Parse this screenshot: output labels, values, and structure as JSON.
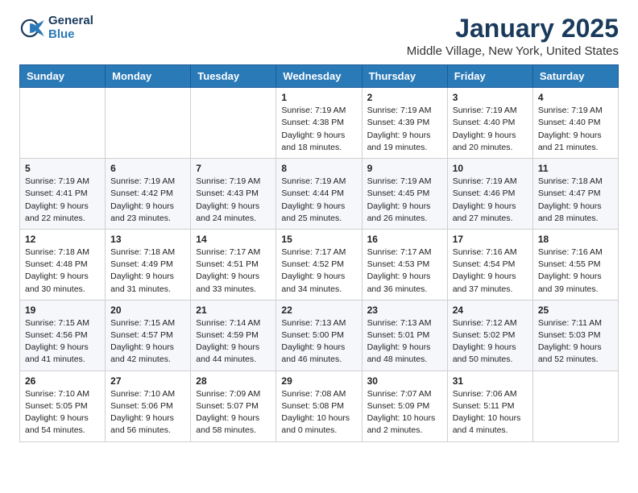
{
  "header": {
    "logo_line1": "General",
    "logo_line2": "Blue",
    "month_title": "January 2025",
    "location": "Middle Village, New York, United States"
  },
  "weekdays": [
    "Sunday",
    "Monday",
    "Tuesday",
    "Wednesday",
    "Thursday",
    "Friday",
    "Saturday"
  ],
  "weeks": [
    [
      {
        "day": "",
        "info": ""
      },
      {
        "day": "",
        "info": ""
      },
      {
        "day": "",
        "info": ""
      },
      {
        "day": "1",
        "info": "Sunrise: 7:19 AM\nSunset: 4:38 PM\nDaylight: 9 hours\nand 18 minutes."
      },
      {
        "day": "2",
        "info": "Sunrise: 7:19 AM\nSunset: 4:39 PM\nDaylight: 9 hours\nand 19 minutes."
      },
      {
        "day": "3",
        "info": "Sunrise: 7:19 AM\nSunset: 4:40 PM\nDaylight: 9 hours\nand 20 minutes."
      },
      {
        "day": "4",
        "info": "Sunrise: 7:19 AM\nSunset: 4:40 PM\nDaylight: 9 hours\nand 21 minutes."
      }
    ],
    [
      {
        "day": "5",
        "info": "Sunrise: 7:19 AM\nSunset: 4:41 PM\nDaylight: 9 hours\nand 22 minutes."
      },
      {
        "day": "6",
        "info": "Sunrise: 7:19 AM\nSunset: 4:42 PM\nDaylight: 9 hours\nand 23 minutes."
      },
      {
        "day": "7",
        "info": "Sunrise: 7:19 AM\nSunset: 4:43 PM\nDaylight: 9 hours\nand 24 minutes."
      },
      {
        "day": "8",
        "info": "Sunrise: 7:19 AM\nSunset: 4:44 PM\nDaylight: 9 hours\nand 25 minutes."
      },
      {
        "day": "9",
        "info": "Sunrise: 7:19 AM\nSunset: 4:45 PM\nDaylight: 9 hours\nand 26 minutes."
      },
      {
        "day": "10",
        "info": "Sunrise: 7:19 AM\nSunset: 4:46 PM\nDaylight: 9 hours\nand 27 minutes."
      },
      {
        "day": "11",
        "info": "Sunrise: 7:18 AM\nSunset: 4:47 PM\nDaylight: 9 hours\nand 28 minutes."
      }
    ],
    [
      {
        "day": "12",
        "info": "Sunrise: 7:18 AM\nSunset: 4:48 PM\nDaylight: 9 hours\nand 30 minutes."
      },
      {
        "day": "13",
        "info": "Sunrise: 7:18 AM\nSunset: 4:49 PM\nDaylight: 9 hours\nand 31 minutes."
      },
      {
        "day": "14",
        "info": "Sunrise: 7:17 AM\nSunset: 4:51 PM\nDaylight: 9 hours\nand 33 minutes."
      },
      {
        "day": "15",
        "info": "Sunrise: 7:17 AM\nSunset: 4:52 PM\nDaylight: 9 hours\nand 34 minutes."
      },
      {
        "day": "16",
        "info": "Sunrise: 7:17 AM\nSunset: 4:53 PM\nDaylight: 9 hours\nand 36 minutes."
      },
      {
        "day": "17",
        "info": "Sunrise: 7:16 AM\nSunset: 4:54 PM\nDaylight: 9 hours\nand 37 minutes."
      },
      {
        "day": "18",
        "info": "Sunrise: 7:16 AM\nSunset: 4:55 PM\nDaylight: 9 hours\nand 39 minutes."
      }
    ],
    [
      {
        "day": "19",
        "info": "Sunrise: 7:15 AM\nSunset: 4:56 PM\nDaylight: 9 hours\nand 41 minutes."
      },
      {
        "day": "20",
        "info": "Sunrise: 7:15 AM\nSunset: 4:57 PM\nDaylight: 9 hours\nand 42 minutes."
      },
      {
        "day": "21",
        "info": "Sunrise: 7:14 AM\nSunset: 4:59 PM\nDaylight: 9 hours\nand 44 minutes."
      },
      {
        "day": "22",
        "info": "Sunrise: 7:13 AM\nSunset: 5:00 PM\nDaylight: 9 hours\nand 46 minutes."
      },
      {
        "day": "23",
        "info": "Sunrise: 7:13 AM\nSunset: 5:01 PM\nDaylight: 9 hours\nand 48 minutes."
      },
      {
        "day": "24",
        "info": "Sunrise: 7:12 AM\nSunset: 5:02 PM\nDaylight: 9 hours\nand 50 minutes."
      },
      {
        "day": "25",
        "info": "Sunrise: 7:11 AM\nSunset: 5:03 PM\nDaylight: 9 hours\nand 52 minutes."
      }
    ],
    [
      {
        "day": "26",
        "info": "Sunrise: 7:10 AM\nSunset: 5:05 PM\nDaylight: 9 hours\nand 54 minutes."
      },
      {
        "day": "27",
        "info": "Sunrise: 7:10 AM\nSunset: 5:06 PM\nDaylight: 9 hours\nand 56 minutes."
      },
      {
        "day": "28",
        "info": "Sunrise: 7:09 AM\nSunset: 5:07 PM\nDaylight: 9 hours\nand 58 minutes."
      },
      {
        "day": "29",
        "info": "Sunrise: 7:08 AM\nSunset: 5:08 PM\nDaylight: 10 hours\nand 0 minutes."
      },
      {
        "day": "30",
        "info": "Sunrise: 7:07 AM\nSunset: 5:09 PM\nDaylight: 10 hours\nand 2 minutes."
      },
      {
        "day": "31",
        "info": "Sunrise: 7:06 AM\nSunset: 5:11 PM\nDaylight: 10 hours\nand 4 minutes."
      },
      {
        "day": "",
        "info": ""
      }
    ]
  ]
}
